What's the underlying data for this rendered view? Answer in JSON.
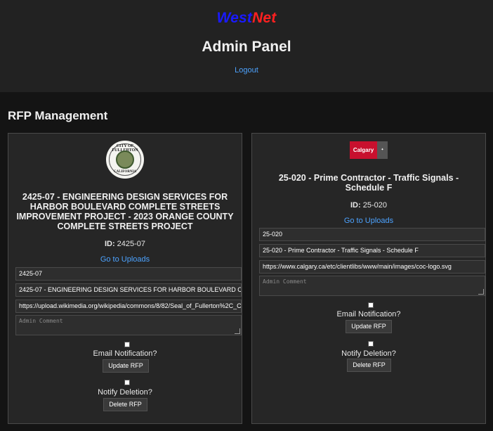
{
  "header": {
    "brand_part1": "West",
    "brand_part2": "Net",
    "title": "Admin Panel",
    "logout": "Logout"
  },
  "section_title": "RFP Management",
  "colors": {
    "background": "#141414",
    "header": "#222222",
    "link": "#4da3ff",
    "brand_blue": "#1a1aff",
    "brand_red": "#ff2020"
  },
  "cards": [
    {
      "logo_icon": "city-of-fullerton-seal",
      "logo_text_top": "CITY OF FULLERTON",
      "logo_text_bottom": "CALIFORNIA",
      "title": "2425-07 - ENGINEERING DESIGN SERVICES FOR HARBOR BOULEVARD COMPLETE STREETS IMPROVEMENT PROJECT - 2023 ORANGE COUNTY COMPLETE STREETS PROJECT",
      "id_label": "ID:",
      "id_value": "2425-07",
      "uploads_link": "Go to Uploads",
      "field_id": "2425-07",
      "field_title": "2425-07 - ENGINEERING DESIGN SERVICES FOR HARBOR BOULEVARD COMPLETE STREETS IMPROVEMENT PROJECT - 2023 ORANGE COUNTY COMPLETE STREETS PROJECT",
      "field_logo_url": "https://upload.wikimedia.org/wikipedia/commons/8/82/Seal_of_Fullerton%2C_California.png",
      "comment_placeholder": "Admin Comment",
      "email_label": "Email Notification?",
      "update_button": "Update RFP",
      "delete_label": "Notify Deletion?",
      "delete_button": "Delete RFP"
    },
    {
      "logo_icon": "calgary-logo",
      "logo_text_top": "Calgary",
      "logo_text_bottom": "",
      "title": "25-020 - Prime Contractor - Traffic Signals - Schedule F",
      "id_label": "ID:",
      "id_value": "25-020",
      "uploads_link": "Go to Uploads",
      "field_id": "25-020",
      "field_title": "25-020 - Prime Contractor - Traffic Signals - Schedule F",
      "field_logo_url": "https://www.calgary.ca/etc/clientlibs/www/main/images/coc-logo.svg",
      "comment_placeholder": "Admin Comment",
      "email_label": "Email Notification?",
      "update_button": "Update RFP",
      "delete_label": "Notify Deletion?",
      "delete_button": "Delete RFP"
    }
  ]
}
